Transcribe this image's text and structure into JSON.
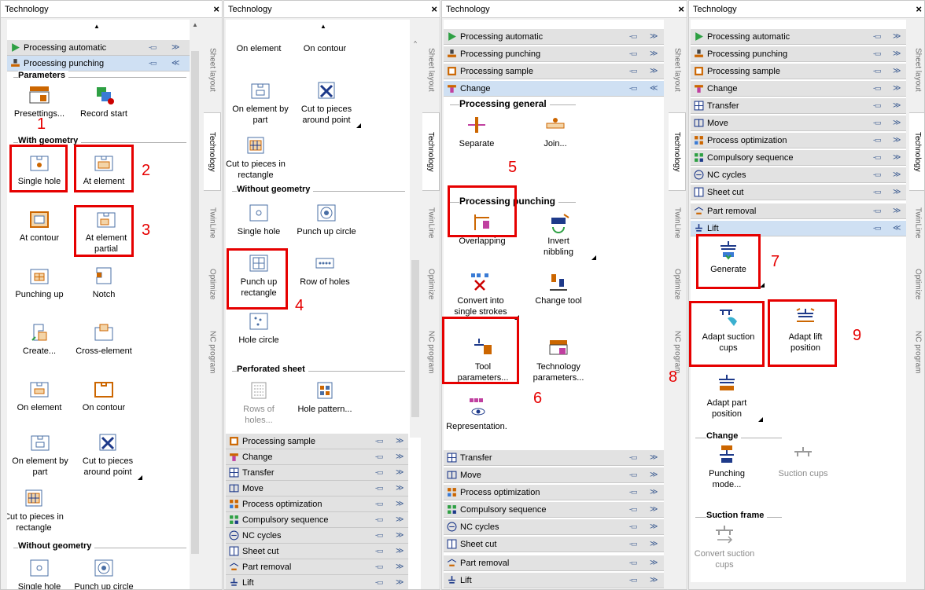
{
  "panel_title": "Technology",
  "close": "×",
  "vtabs": [
    "Sheet layout",
    "Technology",
    "TwinLine",
    "Optimize",
    "NC program"
  ],
  "groups": {
    "processing_automatic": "Processing automatic",
    "processing_punching": "Processing punching",
    "processing_sample": "Processing sample",
    "change": "Change",
    "transfer": "Transfer",
    "move": "Move",
    "process_optimization": "Process optimization",
    "compulsory_sequence": "Compulsory sequence",
    "nc_cycles": "NC cycles",
    "sheet_cut": "Sheet cut",
    "part_removal": "Part removal",
    "lift": "Lift"
  },
  "pin_glyph": "-▭",
  "chevron_down": "≫",
  "chevron_up": "≪",
  "sections": {
    "parameters": "Parameters",
    "with_geometry": "With geometry",
    "without_geometry": "Without geometry",
    "perforated_sheet": "Perforated sheet",
    "processing_general": "Processing general",
    "processing_punching": "Processing punching",
    "change": "Change",
    "suction_frame": "Suction frame"
  },
  "buttons": {
    "presettings": "Presettings...",
    "record_start": "Record start",
    "single_hole": "Single hole",
    "at_element": "At element",
    "at_contour": "At contour",
    "at_element_partial": "At element partial",
    "punching_up": "Punching up",
    "notch": "Notch",
    "create": "Create...",
    "cross_element": "Cross-element",
    "on_element": "On element",
    "on_contour": "On contour",
    "on_element_by_part": "On element by part",
    "cut_to_pieces_around_point": "Cut to pieces around point",
    "cut_to_pieces_in_rectangle": "Cut to pieces in rectangle",
    "punch_up_circle": "Punch up circle",
    "punch_up_rectangle": "Punch up rectangle",
    "row_of_holes": "Row of holes",
    "hole_circle": "Hole circle",
    "rows_of_holes": "Rows of holes...",
    "hole_pattern": "Hole pattern...",
    "separate": "Separate",
    "join": "Join...",
    "overlapping": "Overlapping",
    "invert_nibbling": "Invert nibbling",
    "convert_single_strokes": "Convert into single strokes",
    "change_tool": "Change tool",
    "tool_parameters": "Tool parameters...",
    "technology_parameters": "Technology parameters...",
    "representation": "Representation.",
    "generate": "Generate",
    "adapt_suction_cups": "Adapt suction cups",
    "adapt_lift_position": "Adapt lift position",
    "adapt_part_position": "Adapt part position",
    "punching_mode": "Punching mode...",
    "suction_cups": "Suction cups",
    "convert_suction_cups": "Convert suction cups"
  },
  "annotations": [
    "1",
    "2",
    "3",
    "4",
    "5",
    "6",
    "7",
    "8",
    "9"
  ],
  "colors": {
    "highlight": "#e60000",
    "accent": "#3a5a90",
    "active_group": "#cfe0f3"
  }
}
